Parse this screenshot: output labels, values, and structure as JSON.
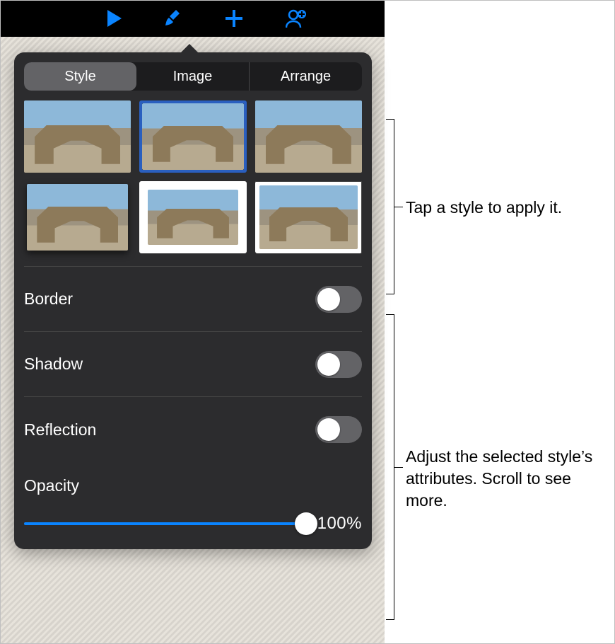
{
  "toolbar": {
    "icons": {
      "play": "play-icon",
      "brush": "brush-icon",
      "plus": "plus-icon",
      "addperson": "add-person-icon"
    }
  },
  "tabs": {
    "style": "Style",
    "image": "Image",
    "arrange": "Arrange"
  },
  "rows": {
    "border": "Border",
    "shadow": "Shadow",
    "reflection": "Reflection",
    "opacity": "Opacity"
  },
  "opacity": {
    "value_text": "100%",
    "percent": 100
  },
  "toggles": {
    "border": false,
    "shadow": false,
    "reflection": false
  },
  "callouts": {
    "styles": "Tap a style to apply it.",
    "attributes": "Adjust the selected style’s attributes. Scroll to see more."
  }
}
